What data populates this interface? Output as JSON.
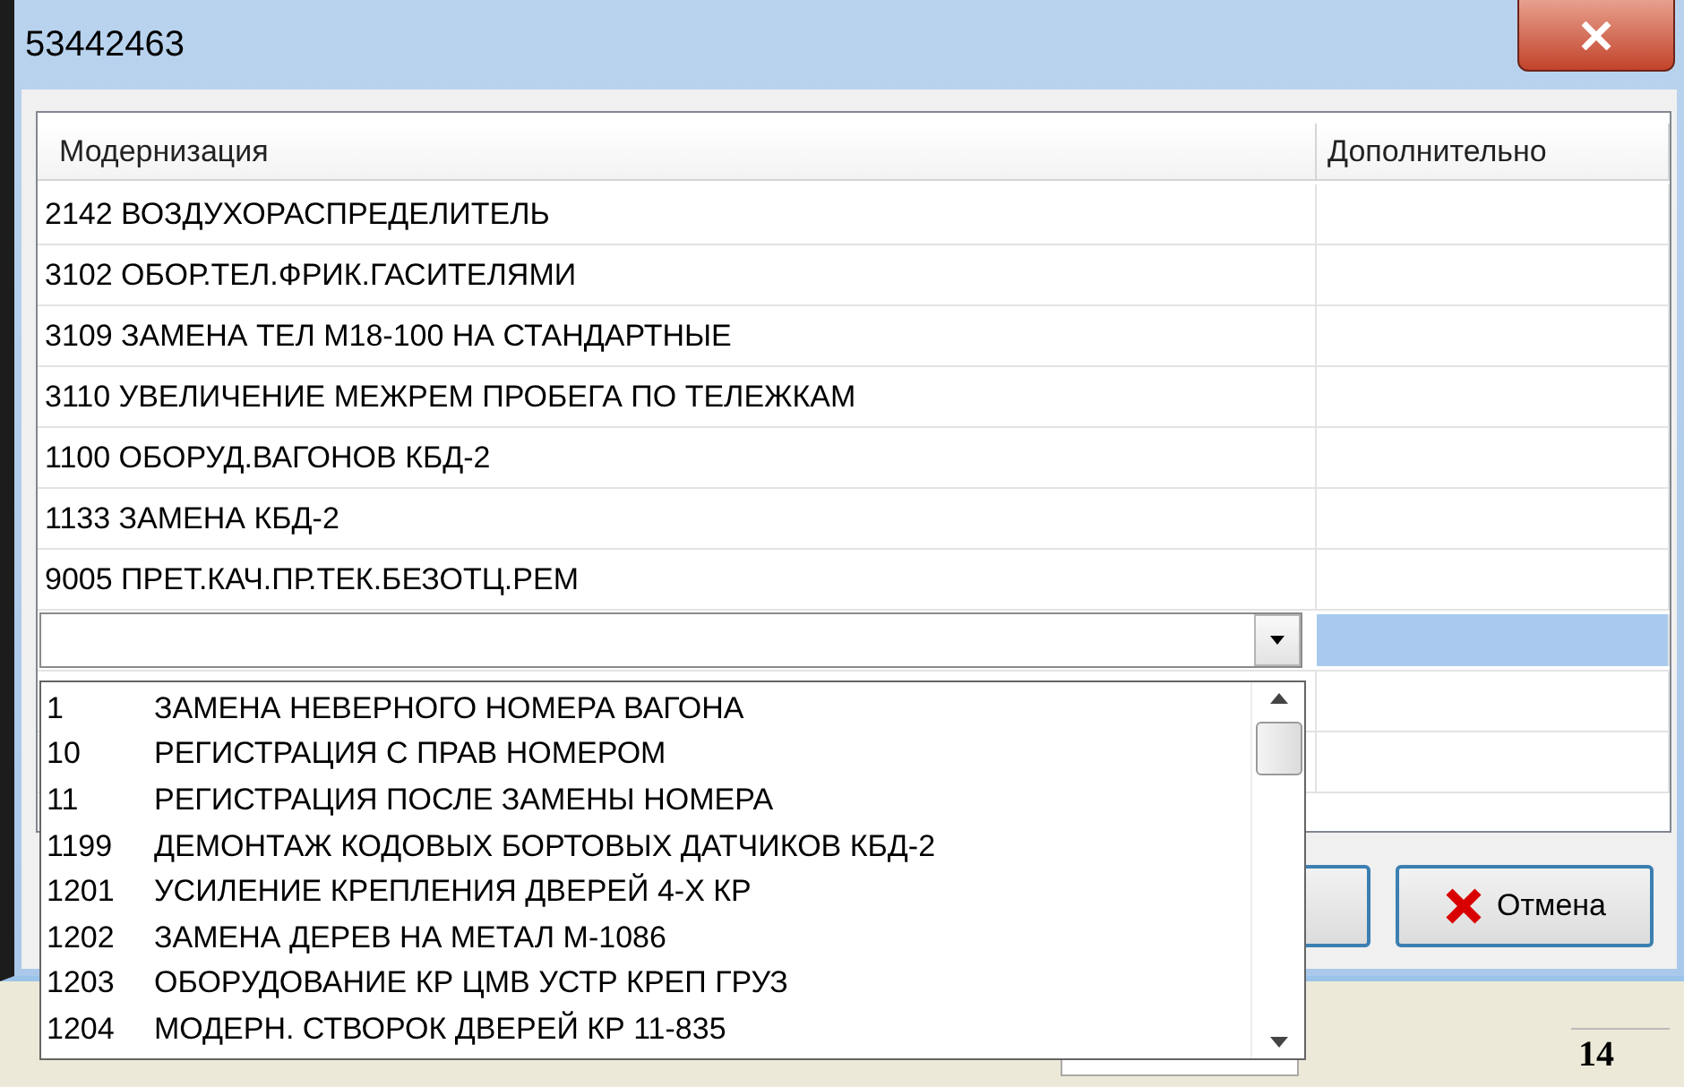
{
  "window": {
    "title": "53442463"
  },
  "table": {
    "columns": [
      "Модернизация",
      "Дополнительно"
    ],
    "rows": [
      {
        "text": "2142 ВОЗДУХОРАСПРЕДЕЛИТЕЛЬ"
      },
      {
        "text": "3102 ОБОР.ТЕЛ.ФРИК.ГАСИТЕЛЯМИ"
      },
      {
        "text": "3109 ЗАМЕНА ТЕЛ М18-100 НА СТАНДАРТНЫЕ"
      },
      {
        "text": "3110 УВЕЛИЧЕНИЕ МЕЖРЕМ ПРОБЕГА ПО ТЕЛЕЖКАМ"
      },
      {
        "text": "1100 ОБОРУД.ВАГОНОВ КБД-2"
      },
      {
        "text": "1133 ЗАМЕНА КБД-2"
      },
      {
        "text": "9005 ПРЕТ.КАЧ.ПР.ТЕК.БЕЗОТЦ.РЕМ"
      }
    ],
    "edit_row": {
      "selected": true
    }
  },
  "dropdown": {
    "expanded": true,
    "items": [
      {
        "code": "1",
        "text": "ЗАМЕНА НЕВЕРНОГО НОМЕРА ВАГОНА"
      },
      {
        "code": "10",
        "text": "РЕГИСТРАЦИЯ С ПРАВ НОМЕРОМ"
      },
      {
        "code": "11",
        "text": "РЕГИСТРАЦИЯ ПОСЛЕ ЗАМЕНЫ НОМЕРА"
      },
      {
        "code": "1199",
        "text": "ДЕМОНТАЖ КОДОВЫХ БОРТОВЫХ ДАТЧИКОВ КБД-2"
      },
      {
        "code": "1201",
        "text": "УСИЛЕНИЕ КРЕПЛЕНИЯ ДВЕРЕЙ 4-Х КР"
      },
      {
        "code": "1202",
        "text": "ЗАМЕНА ДЕРЕВ НА МЕТАЛ М-1086"
      },
      {
        "code": "1203",
        "text": "ОБОРУДОВАНИЕ КР ЦМВ УСТР КРЕП ГРУЗ"
      },
      {
        "code": "1204",
        "text": "МОДЕРН. СТВОРОК ДВЕРЕЙ КР 11-835"
      }
    ]
  },
  "buttons": [
    {
      "kind": "ok"
    },
    {
      "kind": "cancel",
      "label": "Отмена"
    }
  ],
  "background_app": {
    "cell": "14"
  }
}
